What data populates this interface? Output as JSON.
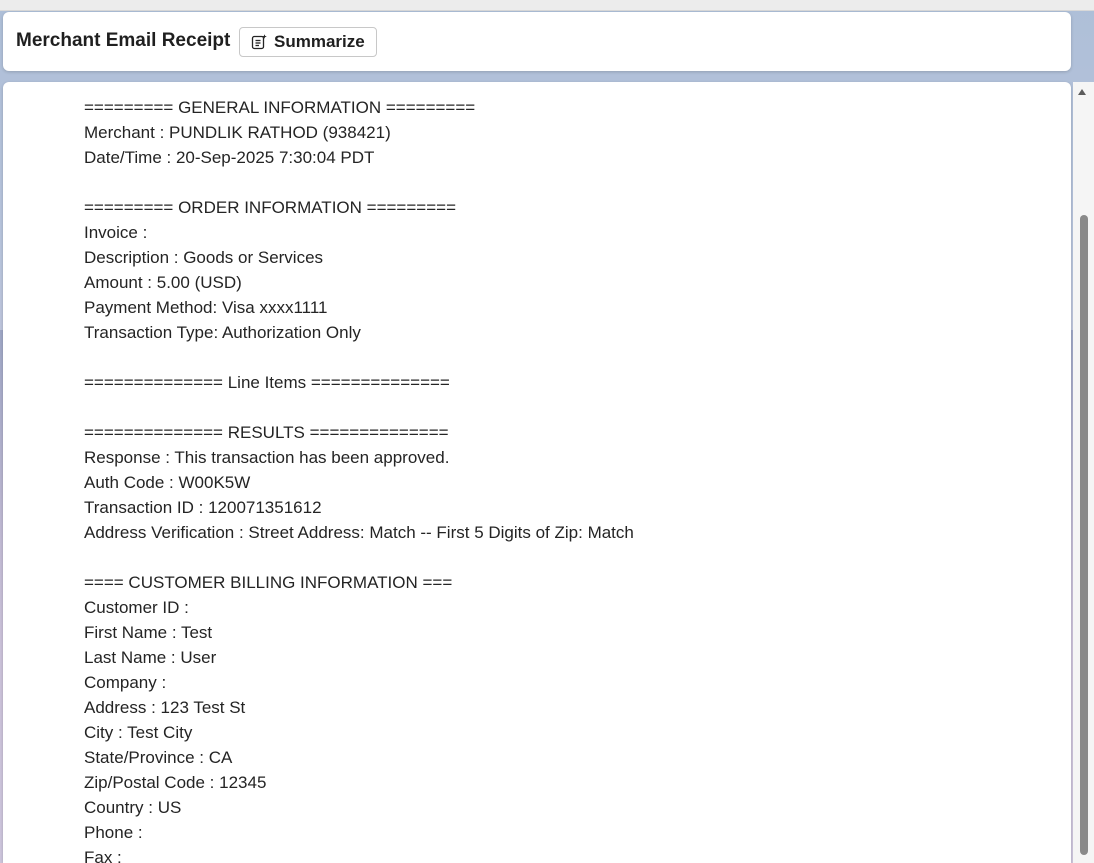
{
  "header": {
    "title": "Merchant Email Receipt",
    "summarize_label": "Summarize",
    "summarize_icon": "summarize-sparkle-icon"
  },
  "receipt": {
    "lines": [
      "========= GENERAL INFORMATION =========",
      "Merchant : PUNDLIK RATHOD (938421)",
      "Date/Time : 20-Sep-2025 7:30:04 PDT",
      "",
      "========= ORDER INFORMATION =========",
      "Invoice :",
      "Description : Goods or Services",
      "Amount : 5.00 (USD)",
      "Payment Method: Visa xxxx1111",
      "Transaction Type: Authorization Only",
      "",
      "============== Line Items ==============",
      "",
      "============== RESULTS ==============",
      "Response : This transaction has been approved.",
      "Auth Code : W00K5W",
      "Transaction ID : 120071351612",
      "Address Verification : Street Address: Match -- First 5 Digits of Zip: Match",
      "",
      "==== CUSTOMER BILLING INFORMATION ===",
      "Customer ID :",
      "First Name : Test",
      "Last Name : User",
      "Company :",
      "Address : 123 Test St",
      "City : Test City",
      "State/Province : CA",
      "Zip/Postal Code : 12345",
      "Country : US",
      "Phone :",
      "Fax :"
    ]
  }
}
